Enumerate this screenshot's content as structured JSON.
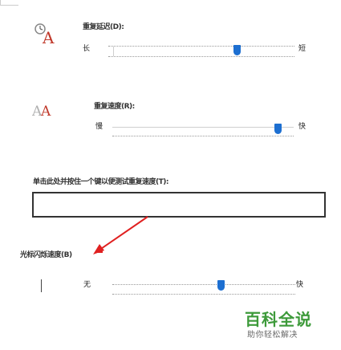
{
  "repeat_delay": {
    "label": "重复延迟(D):",
    "left_label": "长",
    "right_label": "短",
    "value_fraction": 0.7
  },
  "repeat_rate": {
    "label": "重复速度(R):",
    "left_label": "慢",
    "right_label": "快",
    "value_fraction": 0.93
  },
  "test_area": {
    "label": "单击此处并按住一个键以便测试重复速度(T):",
    "value": ""
  },
  "cursor_blink": {
    "label": "光标闪烁速度(B)",
    "left_label": "无",
    "right_label": "快",
    "value_fraction": 0.6
  },
  "watermark": {
    "title": "百科全说",
    "subtitle": "助你轻松解决"
  },
  "colors": {
    "accent": "#1d6fd1",
    "arrow": "#e02020",
    "watermark_green": "#3d9a3a"
  }
}
